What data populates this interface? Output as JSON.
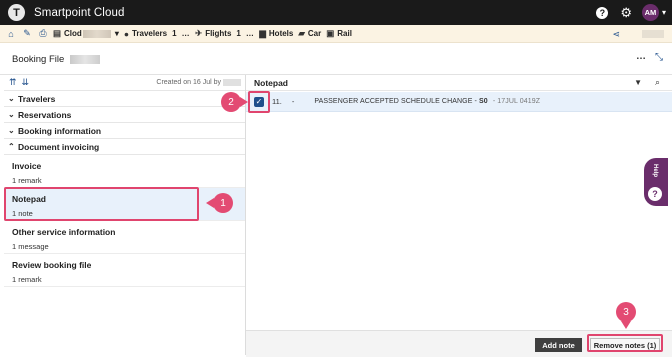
{
  "app": {
    "title": "Smartpoint Cloud",
    "logo_letter": "T",
    "user_initials": "AM",
    "help_symbol": "?",
    "accent": "#1f4f8b",
    "brand": "#6a2d6b"
  },
  "nav": {
    "icons": [
      "home-icon",
      "wrench-icon",
      "printer-icon"
    ],
    "pnr_label": "Clod",
    "travelers_label": "Travelers",
    "travelers_count": "1",
    "flights_label": "Flights",
    "flights_count": "1",
    "hotels_label": "Hotels",
    "car_label": "Car",
    "rail_label": "Rail",
    "more": "…"
  },
  "header": {
    "title": "Booking File",
    "more": "…"
  },
  "left_panel": {
    "created_text": "Created on 16 Jul by",
    "sections": [
      {
        "label": "Travelers",
        "expanded": false
      },
      {
        "label": "Reservations",
        "expanded": false
      },
      {
        "label": "Booking information",
        "expanded": false
      },
      {
        "label": "Document invoicing",
        "expanded": true
      }
    ],
    "items": [
      {
        "title": "Invoice",
        "sub": "1 remark"
      },
      {
        "title": "Notepad",
        "sub": "1 note"
      },
      {
        "title": "Other service information",
        "sub": "1 message"
      },
      {
        "title": "Review booking file",
        "sub": "1 remark"
      }
    ]
  },
  "notepad": {
    "title": "Notepad",
    "note": {
      "number": "11.",
      "dash": "-",
      "text": "PASSENGER ACCEPTED SCHEDULE CHANGE",
      "sep": "-",
      "code": "S0",
      "timestamp": "- 17JUL 0419Z"
    },
    "add_button": "Add note",
    "remove_button": "Remove notes (1)"
  },
  "help_tab": {
    "label": "Help",
    "symbol": "?"
  },
  "callouts": [
    "1",
    "2",
    "3"
  ],
  "highlight_color": "#e0456e"
}
